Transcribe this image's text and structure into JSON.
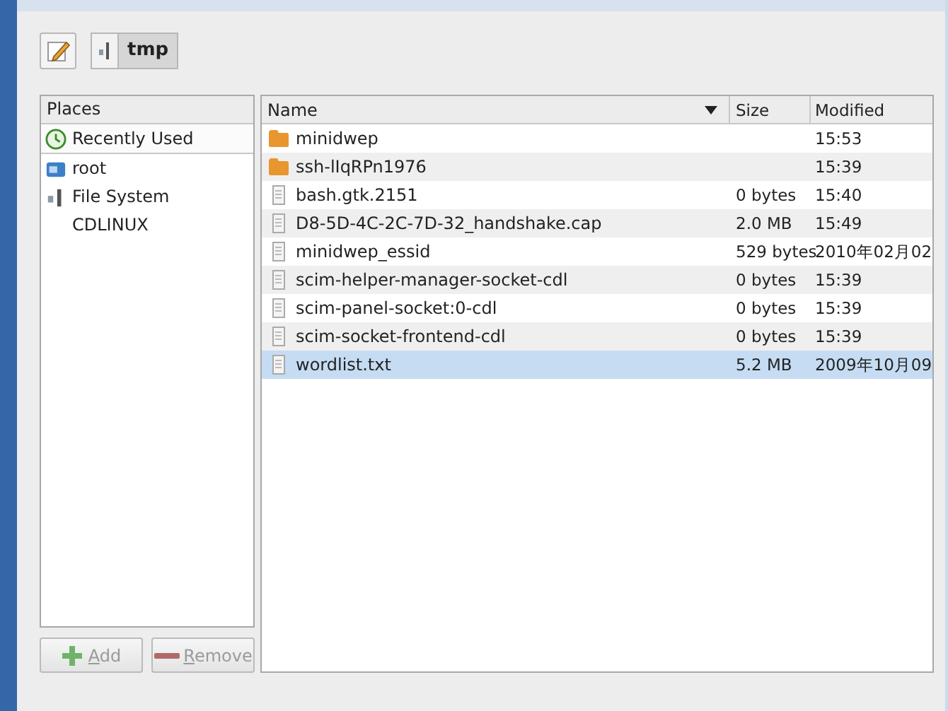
{
  "toolbar": {
    "path_buttons": [
      {
        "label": "tmp",
        "selected": true
      }
    ]
  },
  "places": {
    "header": "Places",
    "items": [
      {
        "label": "Recently Used",
        "kind": "recent",
        "selected": true
      },
      {
        "label": "root",
        "kind": "home",
        "selected": false
      },
      {
        "label": "File System",
        "kind": "drive",
        "selected": false
      },
      {
        "label": "CDLINUX",
        "kind": "plain",
        "selected": false
      }
    ],
    "buttons": [
      {
        "label": "Add",
        "kind": "add",
        "disabled": true
      },
      {
        "label": "Remove",
        "kind": "remove",
        "disabled": true
      }
    ]
  },
  "files": {
    "columns": [
      "Name",
      "Size",
      "Modified"
    ],
    "rows": [
      {
        "name": "minidwep",
        "size": "",
        "modified": "15:53",
        "kind": "folder",
        "selected": false
      },
      {
        "name": "ssh-lIqRPn1976",
        "size": "",
        "modified": "15:39",
        "kind": "folder",
        "selected": false
      },
      {
        "name": "bash.gtk.2151",
        "size": "0 bytes",
        "modified": "15:40",
        "kind": "file",
        "selected": false
      },
      {
        "name": "D8-5D-4C-2C-7D-32_handshake.cap",
        "size": "2.0 MB",
        "modified": "15:49",
        "kind": "file",
        "selected": false
      },
      {
        "name": "minidwep_essid",
        "size": "529 bytes",
        "modified": "2010年02月02",
        "kind": "file",
        "selected": false
      },
      {
        "name": "scim-helper-manager-socket-cdl",
        "size": "0 bytes",
        "modified": "15:39",
        "kind": "file",
        "selected": false
      },
      {
        "name": "scim-panel-socket:0-cdl",
        "size": "0 bytes",
        "modified": "15:39",
        "kind": "file",
        "selected": false
      },
      {
        "name": "scim-socket-frontend-cdl",
        "size": "0 bytes",
        "modified": "15:39",
        "kind": "file",
        "selected": false
      },
      {
        "name": "wordlist.txt",
        "size": "5.2 MB",
        "modified": "2009年10月09",
        "kind": "file",
        "selected": true
      }
    ]
  }
}
